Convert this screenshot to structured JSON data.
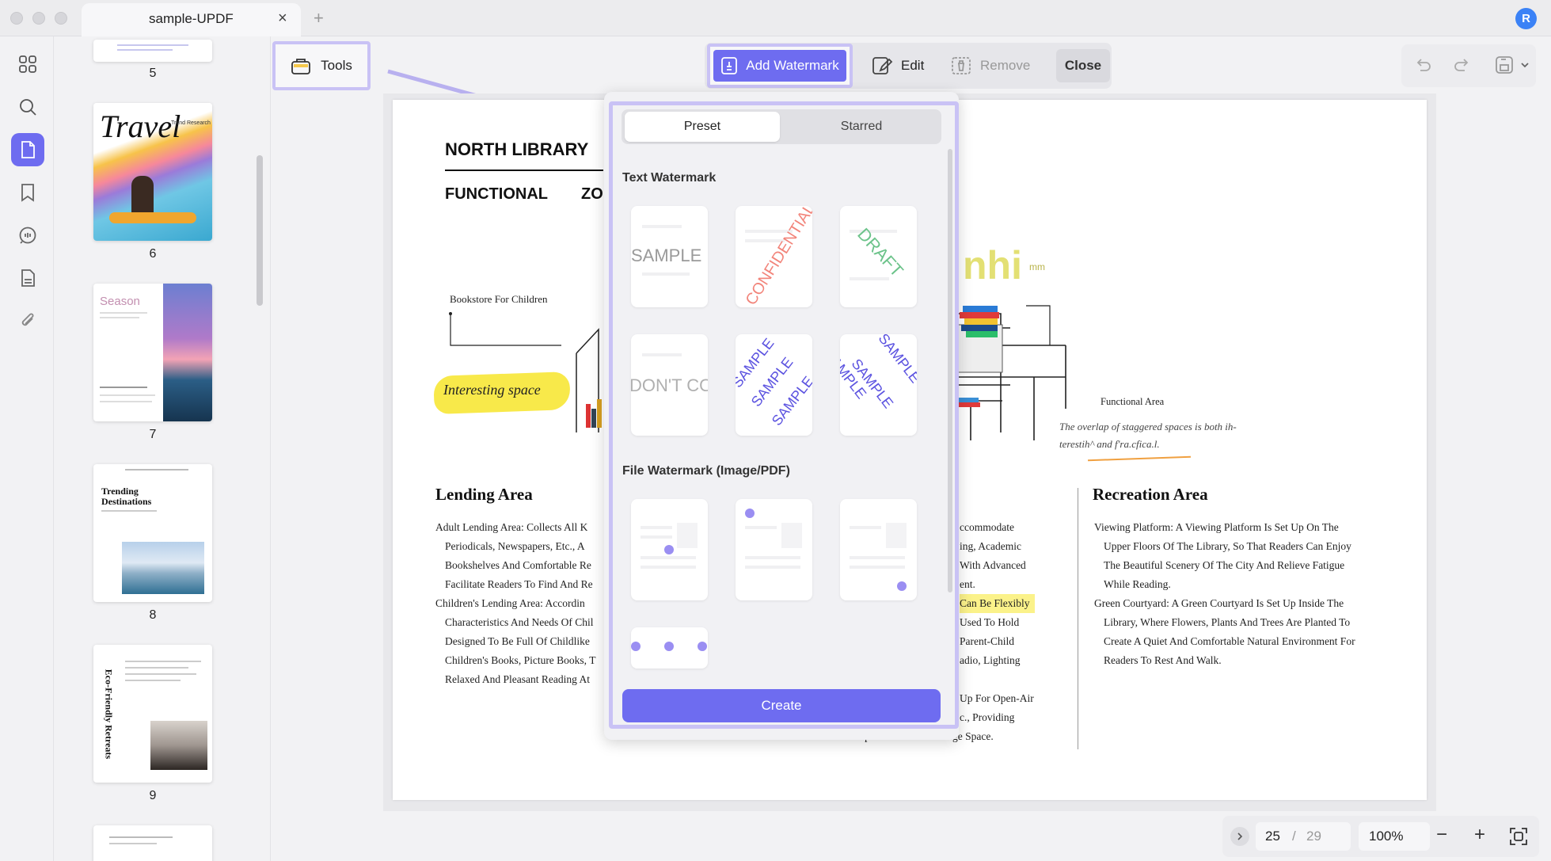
{
  "tab": {
    "title": "sample-UPDF",
    "close": "×",
    "add": "+"
  },
  "user": {
    "avatar_initial": "R"
  },
  "thumbnails": {
    "pages": [
      {
        "num": "5",
        "title": ""
      },
      {
        "num": "6",
        "title": "Travel",
        "subtitle": "Trend Research"
      },
      {
        "num": "7",
        "title": "Season"
      },
      {
        "num": "8",
        "title": "Trending Destinations"
      },
      {
        "num": "9",
        "title": "Eco-Friendly Retreats"
      }
    ]
  },
  "toolbar": {
    "tools_label": "Tools",
    "add_watermark_label": "Add Watermark",
    "edit_label": "Edit",
    "remove_label": "Remove",
    "close_label": "Close"
  },
  "popover": {
    "tab_preset": "Preset",
    "tab_starred": "Starred",
    "text_section": "Text Watermark",
    "file_section": "File Watermark (Image/PDF)",
    "text_presets": [
      "SAMPLE",
      "CONFIDENTIAL",
      "DRAFT",
      "DON'T COPY",
      "SAMPLE",
      "SAMPLE"
    ],
    "tiled_word": "SAMPLE",
    "create_label": "Create",
    "colors": {
      "accent": "#6e6cf0",
      "confidential": "#f2847a",
      "draft": "#6cc38a",
      "sample_tiled": "#5b52e0"
    }
  },
  "document": {
    "heading1": "NORTH LIBRARY",
    "heading2": "FUNCTIONAL",
    "heading2b": "ZO",
    "bookstore_label": "Bookstore For Children",
    "interesting_space": "Interesting space",
    "functional_area": "Functional Area",
    "overlap_text": "The overlap of staggered spaces is both ih-terestih^ and f'ra.cfica.l.",
    "partial_logo": "nhi",
    "partial_logo_small": "mm",
    "lending_title": "Lending Area",
    "lending_items": [
      "Adult Lending Area: Collects All K Periodicals, Newspapers, Etc., A Bookshelves And Comfortable Re Facilitate Readers To Find And Re",
      "Children's Lending Area: Accordin Characteristics And Needs Of Chil Designed To Be Full Of Childlike Children's Books, Picture Books, T Relaxed And Pleasant Reading At"
    ],
    "middle_lines": [
      "ccommodate",
      "ing, Academic",
      "With Advanced",
      "ent.",
      "Can Be Flexibly",
      "Used To Hold",
      "Parent-Child",
      "adio, Lighting",
      "",
      "Up For Open-Air",
      "c., Providing",
      "Citizens With An Open Cultural Exchange Space."
    ],
    "recreation_title": "Recreation Area",
    "recreation_items": [
      "Viewing Platform: A Viewing Platform Is Set Up On The Upper Floors Of The Library, So That Readers Can Enjoy The Beautiful Scenery Of The City And Relieve Fatigue While Reading.",
      "Green Courtyard: A Green Courtyard Is Set Up Inside The Library, Where Flowers, Plants And Trees Are Planted To Create A Quiet And Comfortable Natural Environment For Readers To Rest And Walk."
    ]
  },
  "pagination": {
    "current": "25",
    "separator": "/",
    "total": "29",
    "zoom": "100%",
    "zoom_out": "−",
    "zoom_in": "+"
  }
}
